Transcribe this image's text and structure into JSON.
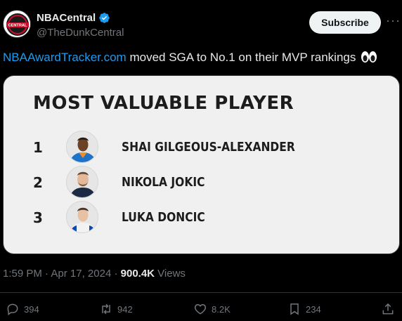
{
  "author": {
    "display_name": "NBACentral",
    "handle": "@TheDunkCentral",
    "avatar_text": "CENTRAL"
  },
  "subscribe_label": "Subscribe",
  "more_label": "···",
  "tweet": {
    "link_text": "NBAAwardTracker.com",
    "body_text": " moved SGA to No.1 on their MVP rankings"
  },
  "card": {
    "title": "MOST VALUABLE PLAYER",
    "players": [
      {
        "rank": "1",
        "name": "SHAI GILGEOUS-ALEXANDER"
      },
      {
        "rank": "2",
        "name": "NIKOLA JOKIC"
      },
      {
        "rank": "3",
        "name": "LUKA DONCIC"
      }
    ]
  },
  "meta": {
    "time": "1:59 PM",
    "sep1": " · ",
    "date": "Apr 17, 2024",
    "sep2": " · ",
    "views_count": "900.4K",
    "views_label": " Views"
  },
  "actions": {
    "replies": "394",
    "reposts": "942",
    "likes": "8.2K",
    "bookmarks": "234"
  },
  "colors": {
    "background": "#000000",
    "link": "#1d9bf0",
    "verified": "#1d9bf0",
    "muted": "#71767b",
    "card_bg": "#f0f0f0"
  },
  "icons": [
    "avatar-logo",
    "verified-badge-icon",
    "more-icon",
    "eyes-emoji-icon",
    "reply-icon",
    "repost-icon",
    "like-icon",
    "bookmark-icon",
    "share-icon"
  ]
}
